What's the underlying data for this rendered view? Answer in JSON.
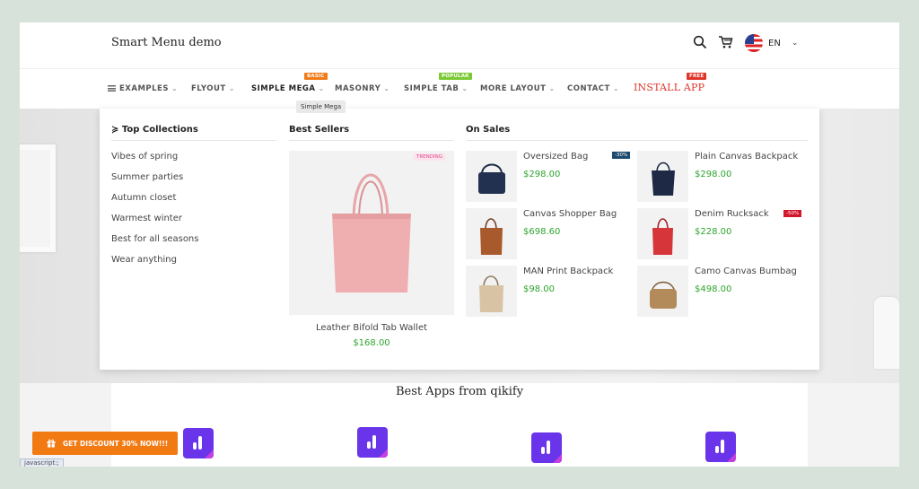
{
  "header": {
    "brand": "Smart Menu demo",
    "language": "EN"
  },
  "nav": {
    "items": [
      {
        "label": "EXAMPLES",
        "chevron": "⌄"
      },
      {
        "label": "FLYOUT",
        "chevron": "⌄"
      },
      {
        "label": "SIMPLE MEGA",
        "chevron": "⌄",
        "badge": "BASIC"
      },
      {
        "label": "MASONRY",
        "chevron": "⌄"
      },
      {
        "label": "SIMPLE TAB",
        "chevron": "⌄",
        "badge": "POPULAR"
      },
      {
        "label": "MORE LAYOUT",
        "chevron": "⌄"
      },
      {
        "label": "CONTACT",
        "chevron": "⌄"
      }
    ],
    "install_label": "INSTALL APP",
    "install_badge": "FREE",
    "tooltip": "Simple Mega"
  },
  "mega_menu": {
    "collections": {
      "title": "Top Collections",
      "links": [
        "Vibes of spring",
        "Summer parties",
        "Autumn closet",
        "Warmest winter",
        "Best for all seasons",
        "Wear anything"
      ]
    },
    "best_sellers": {
      "title": "Best Sellers",
      "badge": "TRENDING",
      "name": "Leather Bifold Tab Wallet",
      "price": "$168.00"
    },
    "on_sales": {
      "title": "On Sales",
      "products": [
        {
          "name": "Oversized Bag",
          "price": "$298.00",
          "badge": "-30%"
        },
        {
          "name": "Plain Canvas Backpack",
          "price": "$298.00"
        },
        {
          "name": "Canvas Shopper Bag",
          "price": "$698.60"
        },
        {
          "name": "Denim Rucksack",
          "price": "$228.00",
          "badge": "-50%"
        },
        {
          "name": "MAN Print Backpack",
          "price": "$98.00"
        },
        {
          "name": "Camo Canvas Bumbag",
          "price": "$498.00"
        }
      ]
    }
  },
  "apps_section": {
    "title": "Best Apps from qikify"
  },
  "discount_button": "GET DISCOUNT 30% NOW!!!",
  "status_text": "javascript:;",
  "colors": {
    "accent_orange": "#f27a12",
    "install_red": "#e0352a",
    "price_green": "#2da52d",
    "app_purple": "#6a35ea",
    "badge_basic": "#f07b1a",
    "badge_popular": "#7bc935",
    "badge_free": "#e0352a"
  }
}
